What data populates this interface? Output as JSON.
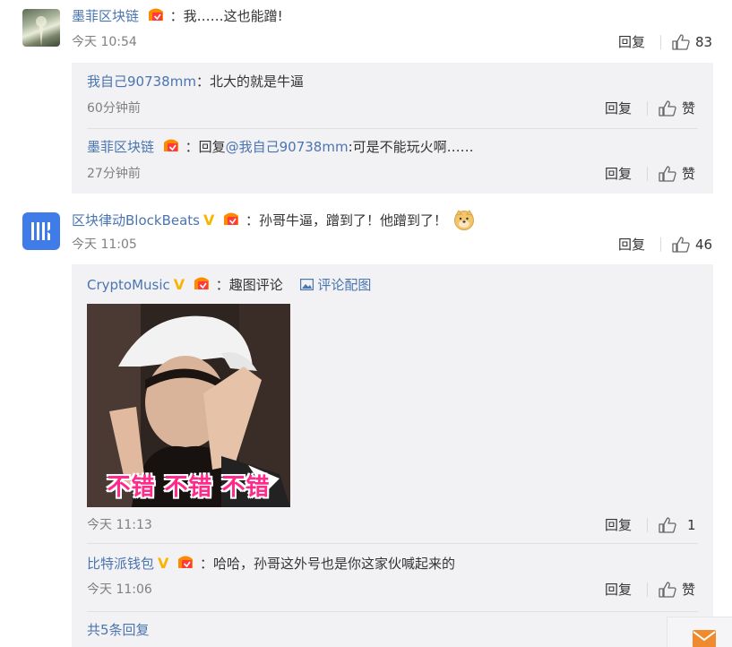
{
  "labels": {
    "reply": "回复",
    "like": "赞",
    "colon": "："
  },
  "comments": [
    {
      "user": "墨菲区块链",
      "text": "我……这也能蹭!",
      "time": "今天 10:54",
      "likes": "83",
      "replies": [
        {
          "user": "我自己90738mm",
          "text": "北大的就是牛逼",
          "time": "60分钟前",
          "likes": "赞"
        },
        {
          "user": "墨菲区块链",
          "reply_prefix": "回复",
          "mention": "@我自己90738mm",
          "text": ":可是不能玩火啊……",
          "time": "27分钟前",
          "likes": "赞"
        }
      ]
    },
    {
      "user": "区块律动BlockBeats",
      "verified": "V",
      "text": "孙哥牛逼，蹭到了！他蹭到了！",
      "time": "今天 11:05",
      "likes": "46",
      "replies": [
        {
          "user": "CryptoMusic",
          "verified": "V",
          "text": "趣图评论",
          "image_link": "评论配图",
          "meme_caption": "不错 不错 不错",
          "time": "今天 11:13",
          "likes": "1"
        },
        {
          "user": "比特派钱包",
          "verified": "V",
          "text": "哈哈，孙哥这外号也是你这家伙喊起来的",
          "time": "今天 11:06",
          "likes": "赞"
        }
      ],
      "more_replies": "共5条回复"
    }
  ],
  "colors": {
    "username": "#4a75b0",
    "reply_bg": "#f2f2f5",
    "verified": "#f7b500",
    "meme_text": "#ff2a8a"
  },
  "icons": [
    "thumb-up-icon",
    "image-icon",
    "fan-badge-icon",
    "verified-v-icon",
    "mail-icon",
    "doge-emoji-icon"
  ]
}
